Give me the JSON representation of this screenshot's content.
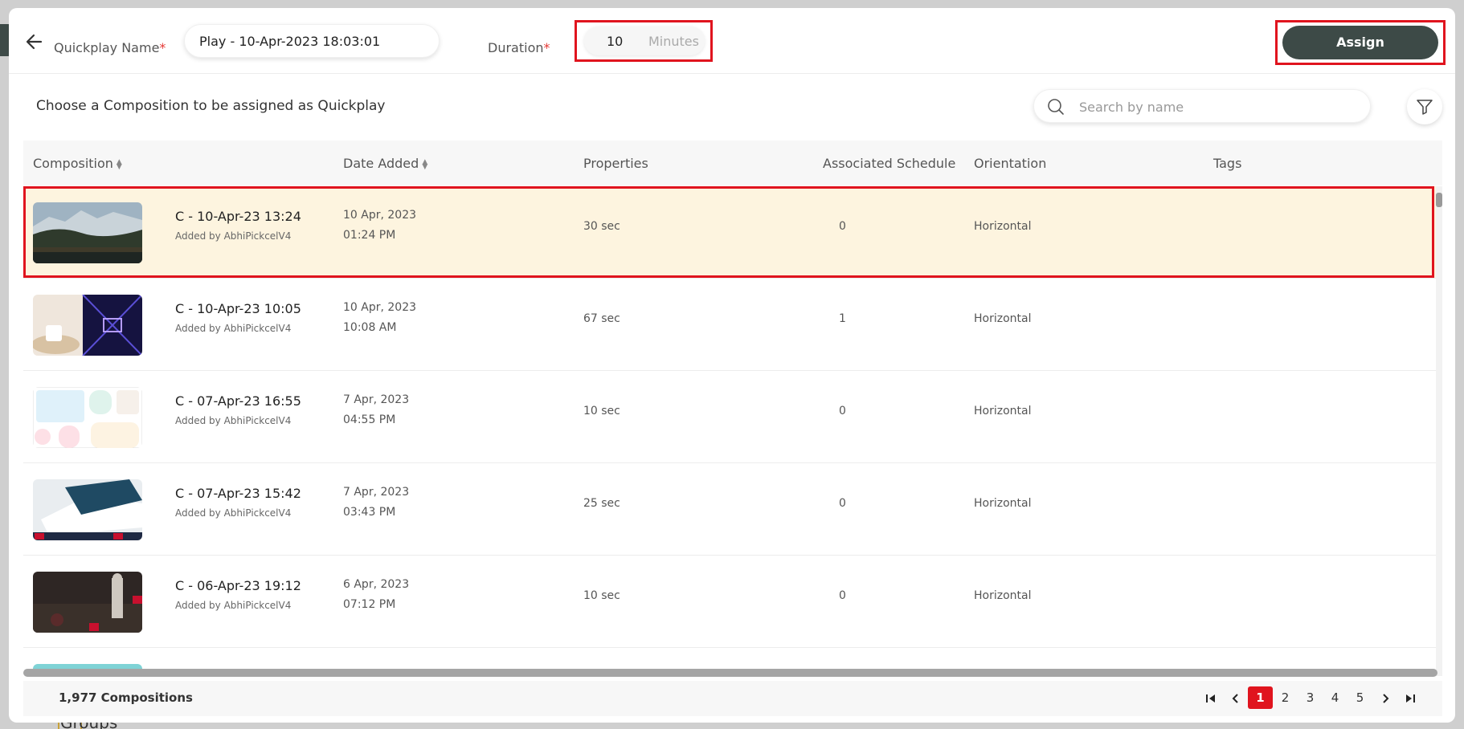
{
  "background": {
    "nav_item": "Groups"
  },
  "header": {
    "quickplay_label": "Quickplay Name",
    "required_mark": "*",
    "quickplay_value": "Play - 10-Apr-2023 18:03:01",
    "duration_label": "Duration",
    "duration_value": "10",
    "duration_unit": "Minutes",
    "assign_label": "Assign"
  },
  "toolbar": {
    "instruction": "Choose a Composition to be assigned as Quickplay",
    "search_placeholder": "Search by name"
  },
  "table": {
    "columns": [
      "Composition",
      "Date Added",
      "Properties",
      "Associated Schedule",
      "Orientation",
      "Tags"
    ],
    "rows": [
      {
        "name": "C - 10-Apr-23 13:24",
        "added_by": "Added by AbhiPickcelV4",
        "date": "10 Apr, 2023",
        "time": "01:24 PM",
        "properties": "30 sec",
        "schedule": "0",
        "orientation": "Horizontal",
        "tags": ""
      },
      {
        "name": "C - 10-Apr-23 10:05",
        "added_by": "Added by AbhiPickcelV4",
        "date": "10 Apr, 2023",
        "time": "10:08 AM",
        "properties": "67 sec",
        "schedule": "1",
        "orientation": "Horizontal",
        "tags": ""
      },
      {
        "name": "C - 07-Apr-23 16:55",
        "added_by": "Added by AbhiPickcelV4",
        "date": "7 Apr, 2023",
        "time": "04:55 PM",
        "properties": "10 sec",
        "schedule": "0",
        "orientation": "Horizontal",
        "tags": ""
      },
      {
        "name": "C - 07-Apr-23 15:42",
        "added_by": "Added by AbhiPickcelV4",
        "date": "7 Apr, 2023",
        "time": "03:43 PM",
        "properties": "25 sec",
        "schedule": "0",
        "orientation": "Horizontal",
        "tags": ""
      },
      {
        "name": "C - 06-Apr-23 19:12",
        "added_by": "Added by AbhiPickcelV4",
        "date": "6 Apr, 2023",
        "time": "07:12 PM",
        "properties": "10 sec",
        "schedule": "0",
        "orientation": "Horizontal",
        "tags": ""
      }
    ]
  },
  "footer": {
    "count": "1,977 Compositions",
    "pages": [
      "1",
      "2",
      "3",
      "4",
      "5"
    ],
    "current_page": "1"
  },
  "colors": {
    "accent": "#e0141e",
    "primary_button": "#3d4a47",
    "selected_row": "#fdf4df"
  }
}
